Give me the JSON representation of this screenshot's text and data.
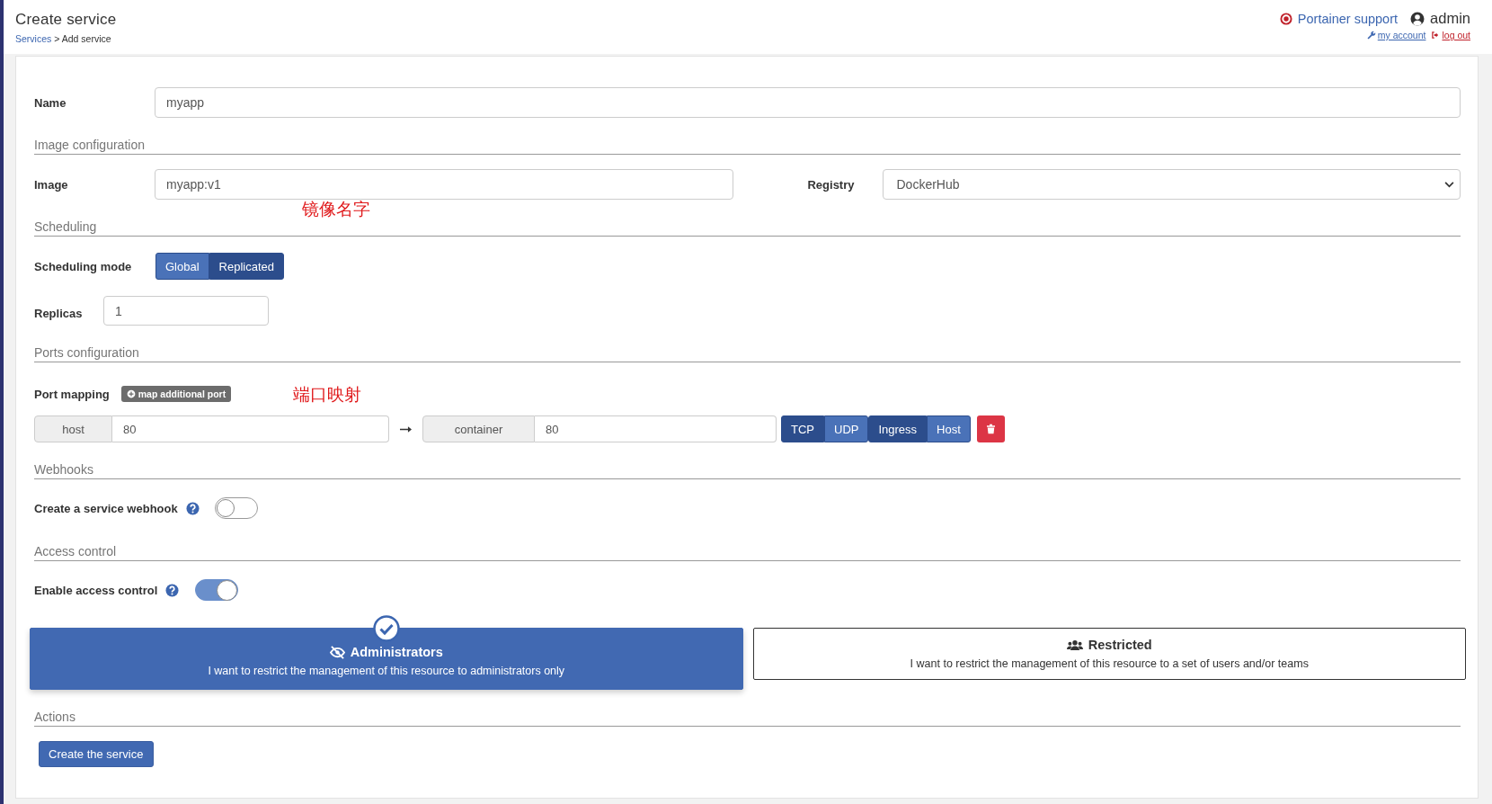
{
  "header": {
    "title": "Create service",
    "breadcrumb_link": "Services",
    "breadcrumb_current": "> Add service",
    "support": "Portainer support",
    "user": "admin",
    "my_account": "my account",
    "log_out": "log out"
  },
  "rows": [
    {
      "kind": "input",
      "label": "Name",
      "value": "myapp"
    },
    {
      "kind": "section",
      "title": "Image configuration"
    },
    {
      "kind": "image",
      "label": "Image",
      "value": "myapp:v1",
      "annotation": "镜像名字",
      "registry_label": "Registry",
      "registry_value": "DockerHub"
    },
    {
      "kind": "section",
      "title": "Scheduling"
    },
    {
      "kind": "segmented",
      "label": "Scheduling mode",
      "options": [
        {
          "label": "Global",
          "selected": false
        },
        {
          "label": "Replicated",
          "selected": true
        }
      ]
    },
    {
      "kind": "short-input",
      "label": "Replicas",
      "value": "1"
    },
    {
      "kind": "section",
      "title": "Ports configuration"
    },
    {
      "kind": "ports",
      "label": "Port mapping",
      "add_label": "map additional port",
      "annotation": "端口映射",
      "mappings": [
        {
          "host_label": "host",
          "host": "80",
          "container_label": "container",
          "container": "80",
          "protocols": [
            {
              "label": "TCP",
              "selected": true
            },
            {
              "label": "UDP",
              "selected": false
            }
          ],
          "modes": [
            {
              "label": "Ingress",
              "selected": true
            },
            {
              "label": "Host",
              "selected": false
            }
          ]
        }
      ]
    },
    {
      "kind": "section",
      "title": "Webhooks"
    },
    {
      "kind": "toggle",
      "label": "Create a service webhook",
      "on": false
    },
    {
      "kind": "section",
      "title": "Access control"
    },
    {
      "kind": "toggle",
      "label": "Enable access control",
      "on": true
    },
    {
      "kind": "access",
      "options": [
        {
          "title": "Administrators",
          "description": "I want to restrict the management of this resource to administrators only",
          "selected": true
        },
        {
          "title": "Restricted",
          "description": "I want to restrict the management of this resource to a set of users and/or teams",
          "selected": false
        }
      ]
    },
    {
      "kind": "section",
      "title": "Actions"
    },
    {
      "kind": "button",
      "label": "Create the service"
    }
  ]
}
